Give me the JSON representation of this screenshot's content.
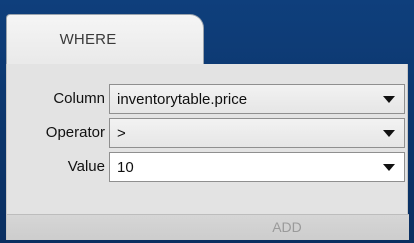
{
  "tabs": [
    {
      "label": "WHERE"
    }
  ],
  "form": {
    "column": {
      "label": "Column",
      "value": "inventorytable.price"
    },
    "operator": {
      "label": "Operator",
      "value": ">"
    },
    "value": {
      "label": "Value",
      "value": "10"
    }
  },
  "actions": {
    "add_label": "ADD"
  },
  "icons": {
    "dropdown": "chevron-down-icon"
  },
  "colors": {
    "background": "#0d3a73",
    "panel": "#e3e3e3",
    "tab": "#f2f2f2",
    "field_border": "#8f8f8f",
    "add_text": "#9a9a9a"
  }
}
